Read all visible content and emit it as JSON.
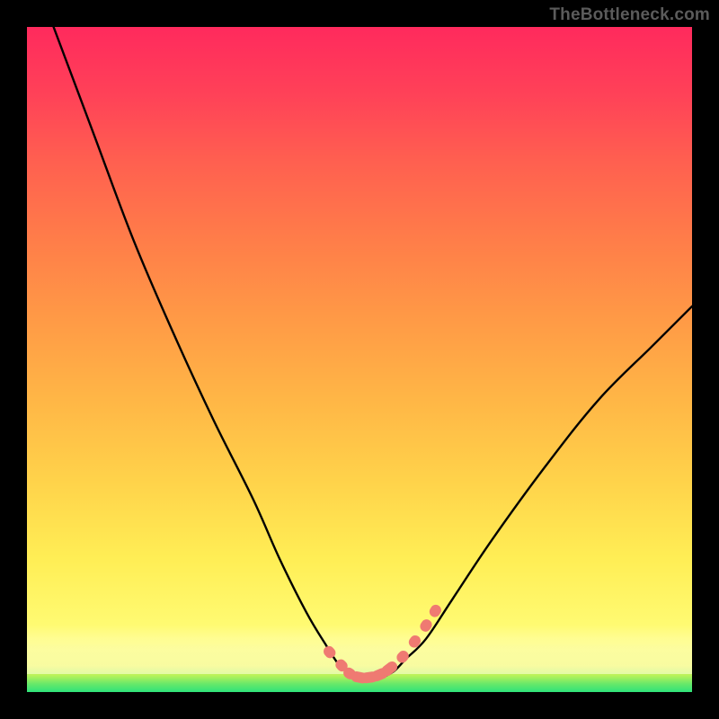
{
  "watermark": {
    "text": "TheBottleneck.com"
  },
  "colors": {
    "curve_stroke": "#000000",
    "marker_fill": "#ef7a72",
    "marker_stroke": "#ef7a72"
  },
  "chart_data": {
    "type": "line",
    "title": "",
    "xlabel": "",
    "ylabel": "",
    "xlim": [
      0,
      100
    ],
    "ylim": [
      0,
      100
    ],
    "series": [
      {
        "name": "bottleneck-curve",
        "x": [
          4,
          10,
          16,
          22,
          28,
          34,
          38,
          42,
          45,
          47,
          49,
          51,
          53,
          55,
          57,
          60,
          64,
          70,
          78,
          86,
          94,
          100
        ],
        "y": [
          100,
          84,
          68,
          54,
          41,
          29,
          20,
          12,
          7,
          4,
          2.5,
          2,
          2.2,
          3,
          5,
          8,
          14,
          23,
          34,
          44,
          52,
          58
        ]
      }
    ],
    "markers": {
      "name": "highlight-dots",
      "x": [
        45.5,
        47.3,
        48.5,
        50.0,
        51.5,
        53.0,
        54.5,
        56.5,
        58.3,
        60.0,
        61.4
      ],
      "y": [
        6.0,
        4.0,
        2.8,
        2.2,
        2.2,
        2.6,
        3.5,
        5.3,
        7.6,
        10.0,
        12.2
      ]
    }
  }
}
